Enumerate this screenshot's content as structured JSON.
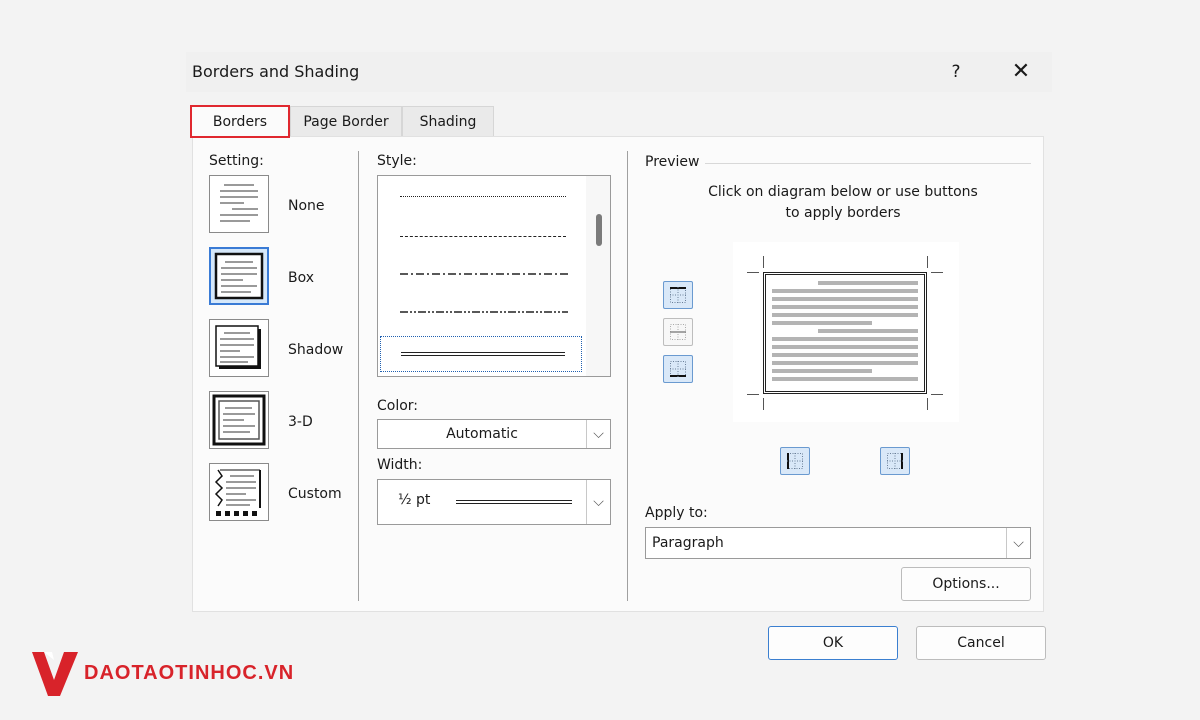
{
  "dialog": {
    "title": "Borders and Shading",
    "help": "?",
    "close": "✕"
  },
  "tabs": [
    {
      "label": "Borders",
      "active": true
    },
    {
      "label": "Page Border",
      "active": false
    },
    {
      "label": "Shading",
      "active": false
    }
  ],
  "setting": {
    "label": "Setting:",
    "options": [
      {
        "label": "None",
        "selected": false
      },
      {
        "label": "Box",
        "selected": true
      },
      {
        "label": "Shadow",
        "selected": false
      },
      {
        "label": "3-D",
        "selected": false
      },
      {
        "label": "Custom",
        "selected": false
      }
    ]
  },
  "style": {
    "label": "Style:",
    "items": [
      "dotted",
      "dashed",
      "dash-dot",
      "dash-dot-dot",
      "double"
    ],
    "selected": "double"
  },
  "color": {
    "label": "Color:",
    "value": "Automatic"
  },
  "width": {
    "label": "Width:",
    "value": "½ pt"
  },
  "preview": {
    "label": "Preview",
    "hint_line1": "Click on diagram below or use buttons",
    "hint_line2": "to apply borders"
  },
  "apply_to": {
    "label": "Apply to:",
    "value": "Paragraph"
  },
  "buttons": {
    "options": "Options...",
    "ok": "OK",
    "cancel": "Cancel"
  },
  "logo": {
    "text": "DAOTAOTINHOC.VN"
  },
  "colors": {
    "accent": "#3a7bd5",
    "highlight": "#e0282f",
    "logo": "#d8232a"
  }
}
